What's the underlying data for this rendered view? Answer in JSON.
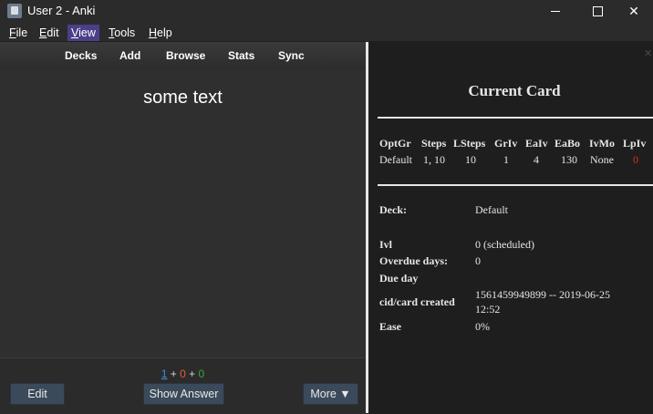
{
  "window": {
    "title": "User 2 - Anki",
    "minimize_label": "",
    "maximize_label": "",
    "close_label": "✕"
  },
  "menu": {
    "file": {
      "pre": "",
      "u": "F",
      "post": "ile"
    },
    "edit": {
      "pre": "",
      "u": "E",
      "post": "dit"
    },
    "view": {
      "pre": "",
      "u": "V",
      "post": "iew"
    },
    "tools": {
      "pre": "",
      "u": "T",
      "post": "ools"
    },
    "help": {
      "pre": "",
      "u": "H",
      "post": "elp"
    }
  },
  "toolbar": {
    "decks": "Decks",
    "add": "Add",
    "browse": "Browse",
    "stats": "Stats",
    "sync": "Sync"
  },
  "reviewer": {
    "question": "some text",
    "counts": {
      "new": "1",
      "plus1": " + ",
      "learn": "0",
      "plus2": " + ",
      "review": "0"
    },
    "edit_button": "Edit",
    "show_answer_button": "Show Answer",
    "more_button": "More ▼"
  },
  "card_info": {
    "close_glyph": "✕",
    "title": "Current Card",
    "options_headers": [
      "OptGr",
      "Steps",
      "LSteps",
      "GrIv",
      "EaIv",
      "EaBo",
      "IvMo",
      "LpIv"
    ],
    "options_values": [
      "Default",
      "1, 10",
      "10",
      "1",
      "4",
      "130",
      "None",
      "0"
    ],
    "rows": [
      {
        "label": "Deck:",
        "value": "Default"
      },
      {
        "label": "Ivl",
        "value": "0 (scheduled)"
      },
      {
        "label": "Overdue days:",
        "value": "0"
      },
      {
        "label": "Due day",
        "value": ""
      },
      {
        "label": "cid/card created",
        "value_line1": "1561459949899  --  2019-06-25",
        "value_line2": "12:52"
      },
      {
        "label": "Ease",
        "value": "0%"
      }
    ]
  },
  "colors": {
    "new_count": "#3a8fe0",
    "learn_count": "#e55a3a",
    "review_count": "#3aa53a",
    "menu_active": "#4b3f8a",
    "lapse_red": "#e02a2a"
  }
}
